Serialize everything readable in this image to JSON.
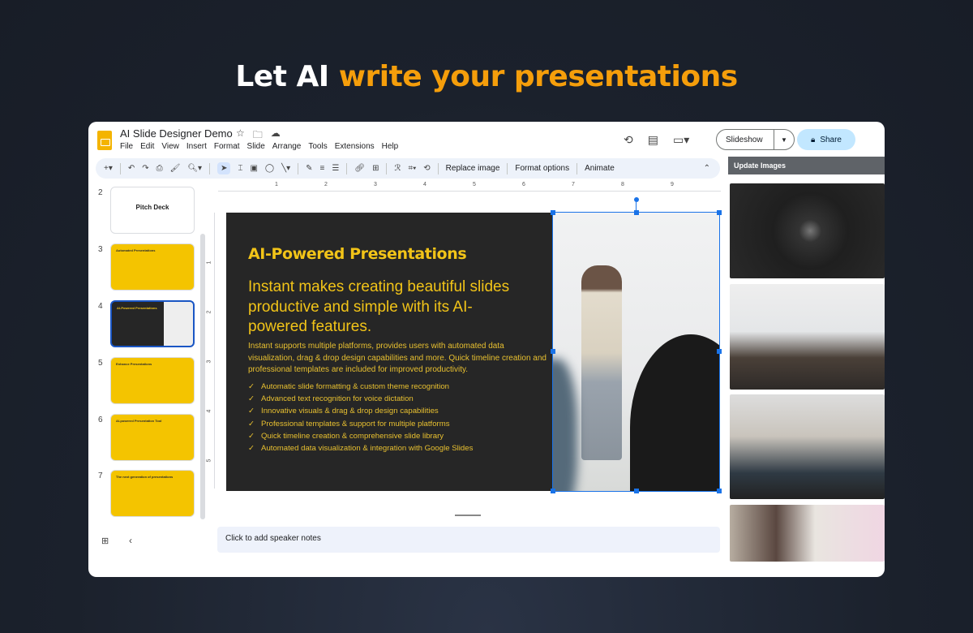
{
  "hero": {
    "prefix": "Let AI",
    "highlight": "write your presentations",
    "highlight_color": "#f59e0b"
  },
  "app": {
    "title": "AI Slide Designer Demo",
    "menu": [
      "File",
      "Edit",
      "View",
      "Insert",
      "Format",
      "Slide",
      "Arrange",
      "Tools",
      "Extensions",
      "Help"
    ],
    "slideshow_label": "Slideshow",
    "share_label": "Share",
    "toolbar": {
      "replace_image": "Replace image",
      "format_options": "Format options",
      "animate": "Animate"
    },
    "ruler_h": [
      "1",
      "2",
      "3",
      "4",
      "5",
      "6",
      "7",
      "8",
      "9"
    ],
    "ruler_v": [
      "1",
      "2",
      "3",
      "4",
      "5"
    ],
    "notes_placeholder": "Click to add speaker notes"
  },
  "side_panel": {
    "title": "Update Images"
  },
  "thumbnails": [
    {
      "number": "2",
      "title": "Pitch Deck"
    },
    {
      "number": "3",
      "title": "Automated Presentations"
    },
    {
      "number": "4",
      "title": "AI-Powered Presentations",
      "selected": true
    },
    {
      "number": "5",
      "title": "Enhance Presentations"
    },
    {
      "number": "6",
      "title": "AI-powered Presentation Tool"
    },
    {
      "number": "7",
      "title": "The next generation of presentations"
    }
  ],
  "slide": {
    "heading": "AI-Powered Presentations",
    "subheading": "Instant makes creating beautiful slides productive and simple with its AI-powered features.",
    "body": "Instant supports multiple platforms, provides users with automated data visualization, drag & drop design capabilities and more. Quick timeline creation and professional templates are included for improved productivity.",
    "bullets": [
      "Automatic slide formatting & custom theme recognition",
      "Advanced text recognition for voice dictation",
      "Innovative visuals & drag & drop design capabilities",
      "Professional templates & support for multiple platforms",
      "Quick timeline creation & comprehensive slide library",
      "Automated data visualization & integration with Google Slides"
    ],
    "accent": "#f2c418"
  }
}
